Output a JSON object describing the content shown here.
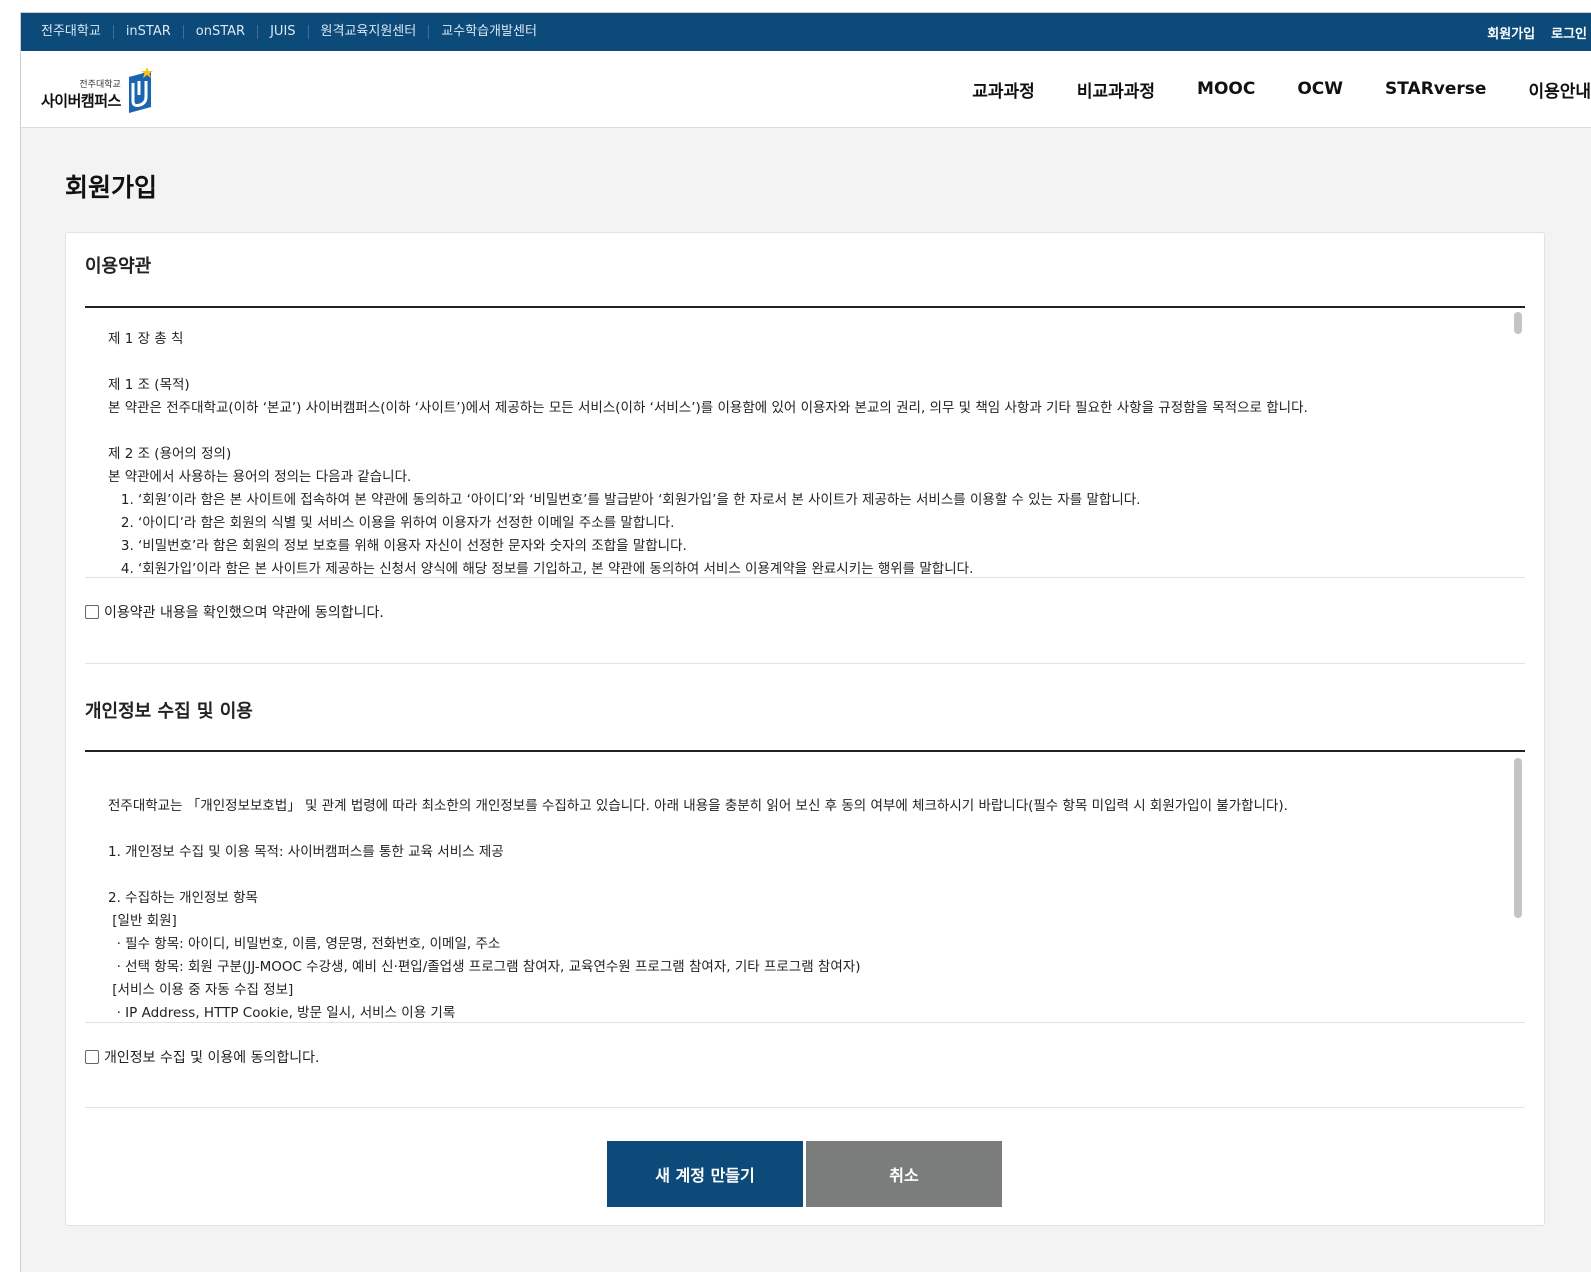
{
  "topbar": {
    "links": [
      "전주대학교",
      "inSTAR",
      "onSTAR",
      "JUIS",
      "원격교육지원센터",
      "교수학습개발센터"
    ],
    "signup": "회원가입",
    "login": "로그인"
  },
  "header": {
    "logo_small": "전주대학교",
    "logo_big": "사이버캠퍼스",
    "nav": [
      "교과과정",
      "비교과과정",
      "MOOC",
      "OCW",
      "STARverse",
      "이용안내"
    ]
  },
  "page": {
    "title": "회원가입"
  },
  "terms": {
    "title": "이용약관",
    "lines": [
      "제 1 장 총 칙",
      "",
      "제 1 조 (목적)",
      "본 약관은 전주대학교(이하 ‘본교’) 사이버캠퍼스(이하 ‘사이트’)에서 제공하는 모든 서비스(이하 ‘서비스’)를 이용함에 있어 이용자와 본교의 권리, 의무 및 책임 사항과 기타 필요한 사항을 규정함을 목적으로 합니다.",
      "",
      "제 2 조 (용어의 정의)",
      "본 약관에서 사용하는 용어의 정의는 다음과 같습니다.",
      "   1. ‘회원’이라 함은 본 사이트에 접속하여 본 약관에 동의하고 ‘아이디’와 ‘비밀번호’를 발급받아 ‘회원가입’을 한 자로서 본 사이트가 제공하는 서비스를 이용할 수 있는 자를 말합니다.",
      "   2. ‘아이디’라 함은 회원의 식별 및 서비스 이용을 위하여 이용자가 선정한 이메일 주소를 말합니다.",
      "   3. ‘비밀번호’라 함은 회원의 정보 보호를 위해 이용자 자신이 선정한 문자와 숫자의 조합을 말합니다.",
      "   4. ‘회원가입’이라 함은 본 사이트가 제공하는 신청서 양식에 해당 정보를 기입하고, 본 약관에 동의하여 서비스 이용계약을 완료시키는 행위를 말합니다."
    ],
    "agree_label": "이용약관 내용을 확인했으며 약관에 동의합니다."
  },
  "privacy": {
    "title": "개인정보 수집 및 이용",
    "lines": [
      "",
      "전주대학교는 「개인정보보호법」 및 관계 법령에 따라 최소한의 개인정보를 수집하고 있습니다. 아래 내용을 충분히 읽어 보신 후 동의 여부에 체크하시기 바랍니다(필수 항목 미입력 시 회원가입이 불가합니다).",
      "",
      "1. 개인정보 수집 및 이용 목적: 사이버캠퍼스를 통한 교육 서비스 제공",
      "",
      "2. 수집하는 개인정보 항목",
      " [일반 회원]",
      "  · 필수 항목: 아이디, 비밀번호, 이름, 영문명, 전화번호, 이메일, 주소",
      "  · 선택 항목: 회원 구분(JJ-MOOC 수강생, 예비 신·편입/졸업생 프로그램 참여자, 교육연수원 프로그램 참여자, 기타 프로그램 참여자)",
      " [서비스 이용 중 자동 수집 정보]",
      "  · IP Address, HTTP Cookie, 방문 일시, 서비스 이용 기록"
    ],
    "agree_label": "개인정보 수집 및 이용에 동의합니다."
  },
  "buttons": {
    "create": "새 계정 만들기",
    "cancel": "취소"
  }
}
